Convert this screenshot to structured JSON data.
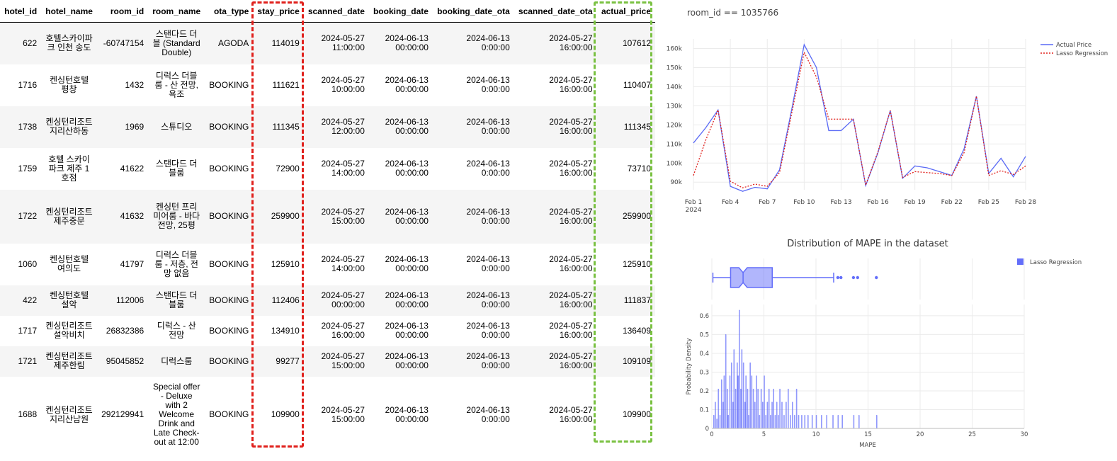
{
  "table": {
    "columns": [
      "hotel_id",
      "hotel_name",
      "room_id",
      "room_name",
      "ota_type",
      "stay_price",
      "scanned_date",
      "booking_date",
      "booking_date_ota",
      "scanned_date_ota",
      "actual_price"
    ],
    "rows": [
      {
        "hotel_id": "622",
        "hotel_name": "호텔스카이파크 인천 송도",
        "room_id": "-60747154",
        "room_name": "스탠다드 더블 (Standard Double)",
        "ota_type": "AGODA",
        "stay_price": "114019",
        "scanned_date": "2024-05-27 11:00:00",
        "booking_date": "2024-06-13 00:00:00",
        "booking_date_ota": "2024-06-13 0:00:00",
        "scanned_date_ota": "2024-05-27 16:00:00",
        "actual_price": "107612",
        "h": 59
      },
      {
        "hotel_id": "1716",
        "hotel_name": "켄싱턴호텔 평창",
        "room_id": "1432",
        "room_name": "디럭스 더블룸 - 산 전망, 욕조",
        "ota_type": "BOOKING",
        "stay_price": "111621",
        "scanned_date": "2024-05-27 10:00:00",
        "booking_date": "2024-06-13 00:00:00",
        "booking_date_ota": "2024-06-13 0:00:00",
        "scanned_date_ota": "2024-05-27 16:00:00",
        "actual_price": "110407",
        "h": 59
      },
      {
        "hotel_id": "1738",
        "hotel_name": "켄싱턴리조트 지리산하동",
        "room_id": "1969",
        "room_name": "스튜디오",
        "ota_type": "BOOKING",
        "stay_price": "111345",
        "scanned_date": "2024-05-27 12:00:00",
        "booking_date": "2024-06-13 00:00:00",
        "booking_date_ota": "2024-06-13 0:00:00",
        "scanned_date_ota": "2024-05-27 16:00:00",
        "actual_price": "111345",
        "h": 59
      },
      {
        "hotel_id": "1759",
        "hotel_name": "호텔 스카이파크 제주 1호점",
        "room_id": "41622",
        "room_name": "스탠다드 더블룸",
        "ota_type": "BOOKING",
        "stay_price": "72900",
        "scanned_date": "2024-05-27 14:00:00",
        "booking_date": "2024-06-13 00:00:00",
        "booking_date_ota": "2024-06-13 0:00:00",
        "scanned_date_ota": "2024-05-27 16:00:00",
        "actual_price": "73710",
        "h": 59
      },
      {
        "hotel_id": "1722",
        "hotel_name": "켄싱턴리조트 제주중문",
        "room_id": "41632",
        "room_name": "켄싱턴 프리미어룸 - 바다 전망, 25평",
        "ota_type": "BOOKING",
        "stay_price": "259900",
        "scanned_date": "2024-05-27 15:00:00",
        "booking_date": "2024-06-13 00:00:00",
        "booking_date_ota": "2024-06-13 0:00:00",
        "scanned_date_ota": "2024-05-27 16:00:00",
        "actual_price": "259900",
        "h": 76
      },
      {
        "hotel_id": "1060",
        "hotel_name": "켄싱턴호텔 여의도",
        "room_id": "41797",
        "room_name": "디럭스 더블룸 - 저층, 전망 없음",
        "ota_type": "BOOKING",
        "stay_price": "125910",
        "scanned_date": "2024-05-27 14:00:00",
        "booking_date": "2024-06-13 00:00:00",
        "booking_date_ota": "2024-06-13 0:00:00",
        "scanned_date_ota": "2024-05-27 16:00:00",
        "actual_price": "125910",
        "h": 59
      },
      {
        "hotel_id": "422",
        "hotel_name": "켄싱턴호텔 설악",
        "room_id": "112006",
        "room_name": "스탠다드 더블룸",
        "ota_type": "BOOKING",
        "stay_price": "112406",
        "scanned_date": "2024-05-27 00:00:00",
        "booking_date": "2024-06-13 00:00:00",
        "booking_date_ota": "2024-06-13 0:00:00",
        "scanned_date_ota": "2024-05-27 16:00:00",
        "actual_price": "111837",
        "h": 43
      },
      {
        "hotel_id": "1717",
        "hotel_name": "켄싱턴리조트 설악비치",
        "room_id": "26832386",
        "room_name": "디럭스 - 산 전망",
        "ota_type": "BOOKING",
        "stay_price": "134910",
        "scanned_date": "2024-05-27 16:00:00",
        "booking_date": "2024-06-13 00:00:00",
        "booking_date_ota": "2024-06-13 0:00:00",
        "scanned_date_ota": "2024-05-27 16:00:00",
        "actual_price": "136409",
        "h": 43
      },
      {
        "hotel_id": "1721",
        "hotel_name": "켄싱턴리조트 제주한림",
        "room_id": "95045852",
        "room_name": "디럭스룸",
        "ota_type": "BOOKING",
        "stay_price": "99277",
        "scanned_date": "2024-05-27 15:00:00",
        "booking_date": "2024-06-13 00:00:00",
        "booking_date_ota": "2024-06-13 0:00:00",
        "scanned_date_ota": "2024-05-27 16:00:00",
        "actual_price": "109109",
        "h": 43
      },
      {
        "hotel_id": "1688",
        "hotel_name": "켄싱턴리조트 지리산남원",
        "room_id": "292129941",
        "room_name": "Special offer - Deluxe with 2 Welcome Drink and Late Check-out at 12:00",
        "ota_type": "BOOKING",
        "stay_price": "109900",
        "scanned_date": "2024-05-27 15:00:00",
        "booking_date": "2024-06-13 00:00:00",
        "booking_date_ota": "2024-06-13 0:00:00",
        "scanned_date_ota": "2024-05-27 16:00:00",
        "actual_price": "109900",
        "h": 108
      }
    ],
    "highlight_colors": {
      "stay_price": "#e0201c",
      "actual_price": "#7ac142"
    }
  },
  "chart_data": [
    {
      "type": "line",
      "title": "room_id == 1035766",
      "x": [
        1,
        2,
        3,
        4,
        5,
        6,
        7,
        8,
        9,
        10,
        11,
        12,
        13,
        14,
        15,
        16,
        17,
        18,
        19,
        20,
        21,
        22,
        23,
        24,
        25,
        26,
        27,
        28
      ],
      "x_tick_labels": [
        "Feb 1",
        "Feb 4",
        "Feb 7",
        "Feb 10",
        "Feb 13",
        "Feb 16",
        "Feb 19",
        "Feb 22",
        "Feb 25",
        "Feb 28"
      ],
      "x_tick_values": [
        1,
        4,
        7,
        10,
        13,
        16,
        19,
        22,
        25,
        28
      ],
      "x_year_label": "2024",
      "y_tick_labels": [
        "90k",
        "100k",
        "110k",
        "120k",
        "130k",
        "140k",
        "150k",
        "160k"
      ],
      "y_tick_values": [
        90000,
        100000,
        110000,
        120000,
        130000,
        140000,
        150000,
        160000
      ],
      "ylim": [
        86000,
        165000
      ],
      "xlim": [
        1,
        28
      ],
      "grid": true,
      "legend_position": "top-right",
      "series": [
        {
          "name": "Actual Price",
          "color": "#5a6af5",
          "dash": "solid",
          "values": [
            110500,
            118500,
            127800,
            87800,
            85200,
            87300,
            86500,
            96500,
            128500,
            162000,
            150000,
            117000,
            117000,
            123000,
            88200,
            105500,
            127500,
            92000,
            98500,
            97500,
            95500,
            93500,
            107500,
            135000,
            94500,
            102500,
            92800,
            103500
          ]
        },
        {
          "name": "Lasso Regression",
          "color": "#e0201c",
          "dash": "dot",
          "values": [
            93500,
            112000,
            127800,
            90500,
            87000,
            89000,
            87800,
            95000,
            126500,
            158000,
            145000,
            123000,
            123000,
            123000,
            88500,
            106000,
            127500,
            92500,
            95500,
            95000,
            94500,
            93500,
            105500,
            135000,
            93500,
            96000,
            94000,
            98500
          ]
        }
      ]
    },
    {
      "type": "histogram",
      "title": "Distribution of MAPE in the dataset",
      "xlabel": "MAPE",
      "ylabel": "Probability Density",
      "x_tick_values": [
        0,
        5,
        10,
        15,
        20,
        25,
        30
      ],
      "x_tick_labels": [
        "0",
        "5",
        "10",
        "15",
        "20",
        "25",
        "30"
      ],
      "y_tick_values": [
        0,
        0.1,
        0.2,
        0.3,
        0.4,
        0.5,
        0.6
      ],
      "y_tick_labels": [
        "0",
        "0.1",
        "0.2",
        "0.3",
        "0.4",
        "0.5",
        "0.6"
      ],
      "xlim": [
        0,
        30
      ],
      "ylim": [
        0,
        0.66
      ],
      "color": "#636efa",
      "legend_position": "top-right",
      "series_name": "Lasso Regression",
      "box": {
        "min": 0.1,
        "q1": 1.8,
        "median": 3.0,
        "q3": 5.8,
        "upper_fence": 11.7,
        "notch_low": 2.6,
        "notch_high": 3.4,
        "outliers": [
          12.1,
          12.4,
          13.6,
          14.0,
          15.8
        ]
      },
      "bins": [
        [
          0.15,
          0.07
        ],
        [
          0.3,
          0.14
        ],
        [
          0.45,
          0.05
        ],
        [
          0.6,
          0.21
        ],
        [
          0.75,
          0.07
        ],
        [
          0.9,
          0.26
        ],
        [
          1.05,
          0.14
        ],
        [
          1.15,
          0.28
        ],
        [
          1.3,
          0.5
        ],
        [
          1.45,
          0.21
        ],
        [
          1.55,
          0.07
        ],
        [
          1.7,
          0.28
        ],
        [
          1.85,
          0.35
        ],
        [
          2.0,
          0.14
        ],
        [
          2.1,
          0.42
        ],
        [
          2.25,
          0.21
        ],
        [
          2.4,
          0.35
        ],
        [
          2.5,
          0.28
        ],
        [
          2.6,
          0.63
        ],
        [
          2.75,
          0.21
        ],
        [
          2.85,
          0.42
        ],
        [
          3.0,
          0.35
        ],
        [
          3.15,
          0.14
        ],
        [
          3.25,
          0.28
        ],
        [
          3.4,
          0.21
        ],
        [
          3.5,
          0.07
        ],
        [
          3.65,
          0.35
        ],
        [
          3.8,
          0.28
        ],
        [
          3.95,
          0.21
        ],
        [
          4.1,
          0.14
        ],
        [
          4.25,
          0.28
        ],
        [
          4.4,
          0.21
        ],
        [
          4.55,
          0.07
        ],
        [
          4.7,
          0.21
        ],
        [
          4.85,
          0.14
        ],
        [
          5.0,
          0.28
        ],
        [
          5.15,
          0.07
        ],
        [
          5.3,
          0.14
        ],
        [
          5.45,
          0.21
        ],
        [
          5.6,
          0.07
        ],
        [
          5.75,
          0.14
        ],
        [
          5.9,
          0.21
        ],
        [
          6.05,
          0.07
        ],
        [
          6.2,
          0.14
        ],
        [
          6.35,
          0.07
        ],
        [
          6.5,
          0.21
        ],
        [
          6.7,
          0.14
        ],
        [
          6.9,
          0.07
        ],
        [
          7.1,
          0.14
        ],
        [
          7.3,
          0.21
        ],
        [
          7.5,
          0.07
        ],
        [
          7.7,
          0.14
        ],
        [
          7.9,
          0.07
        ],
        [
          8.1,
          0.21
        ],
        [
          8.3,
          0.07
        ],
        [
          8.6,
          0.07
        ],
        [
          8.9,
          0.07
        ],
        [
          9.2,
          0.07
        ],
        [
          9.6,
          0.07
        ],
        [
          10.0,
          0.07
        ],
        [
          10.5,
          0.07
        ],
        [
          11.0,
          0.07
        ],
        [
          11.6,
          0.07
        ],
        [
          12.1,
          0.07
        ],
        [
          12.5,
          0.07
        ],
        [
          13.6,
          0.07
        ],
        [
          14.1,
          0.07
        ],
        [
          15.8,
          0.07
        ]
      ]
    }
  ]
}
